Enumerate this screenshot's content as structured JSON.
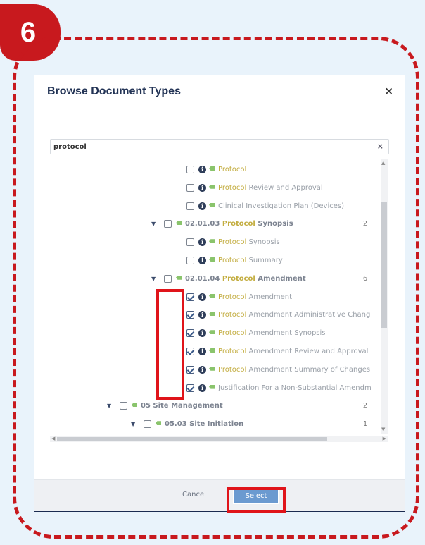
{
  "step": {
    "number": "6"
  },
  "dialog": {
    "title": "Browse Document Types",
    "close_glyph": "×",
    "search": {
      "value": "protocol",
      "clear_glyph": "×"
    },
    "footer": {
      "cancel_label": "Cancel",
      "select_label": "Select"
    }
  },
  "colors": {
    "accent_red": "#e0141a",
    "badge_red": "#c8191e",
    "highlight_text": "#c3ad40",
    "select_button": "#6b9ad0",
    "tag_green": "#8ac46c"
  },
  "tree": [
    {
      "kind": "doc",
      "depth": 3,
      "checked": false,
      "hl": "Protocol",
      "rest": ""
    },
    {
      "kind": "doc",
      "depth": 3,
      "checked": false,
      "hl": "Protocol",
      "rest": " Review and Approval"
    },
    {
      "kind": "doc",
      "depth": 3,
      "checked": false,
      "hl": "",
      "rest": "Clinical Investigation Plan (Devices)"
    },
    {
      "kind": "folder",
      "depth": 2,
      "checked": false,
      "pre": "02.01.03 ",
      "hl": "Protocol",
      "rest": " Synopsis",
      "count": "2"
    },
    {
      "kind": "doc",
      "depth": 3,
      "checked": false,
      "hl": "Protocol",
      "rest": " Synopsis"
    },
    {
      "kind": "doc",
      "depth": 3,
      "checked": false,
      "hl": "Protocol",
      "rest": " Summary"
    },
    {
      "kind": "folder",
      "depth": 2,
      "checked": false,
      "pre": "02.01.04 ",
      "hl": "Protocol",
      "rest": " Amendment",
      "count": "6"
    },
    {
      "kind": "doc",
      "depth": 3,
      "checked": true,
      "hl": "Protocol",
      "rest": " Amendment"
    },
    {
      "kind": "doc",
      "depth": 3,
      "checked": true,
      "hl": "Protocol",
      "rest": " Amendment Administrative Chang"
    },
    {
      "kind": "doc",
      "depth": 3,
      "checked": true,
      "hl": "Protocol",
      "rest": " Amendment Synopsis"
    },
    {
      "kind": "doc",
      "depth": 3,
      "checked": true,
      "hl": "Protocol",
      "rest": " Amendment Review and Approval"
    },
    {
      "kind": "doc",
      "depth": 3,
      "checked": true,
      "hl": "Protocol",
      "rest": " Amendment Summary of Changes"
    },
    {
      "kind": "doc",
      "depth": 3,
      "checked": true,
      "hl": "",
      "rest": "Justification For a Non-Substantial Amendm"
    },
    {
      "kind": "folder",
      "depth": 0,
      "checked": false,
      "pre": "05 Site Management",
      "hl": "",
      "rest": "",
      "count": "2"
    },
    {
      "kind": "folder",
      "depth": 1,
      "checked": false,
      "pre": "05.03 Site Initiation",
      "hl": "",
      "rest": "",
      "count": "1"
    }
  ],
  "icons": {
    "expand": "expand-triangle-icon",
    "info": "info-icon",
    "tag": "tag-icon",
    "checkbox": "checkbox-icon"
  }
}
